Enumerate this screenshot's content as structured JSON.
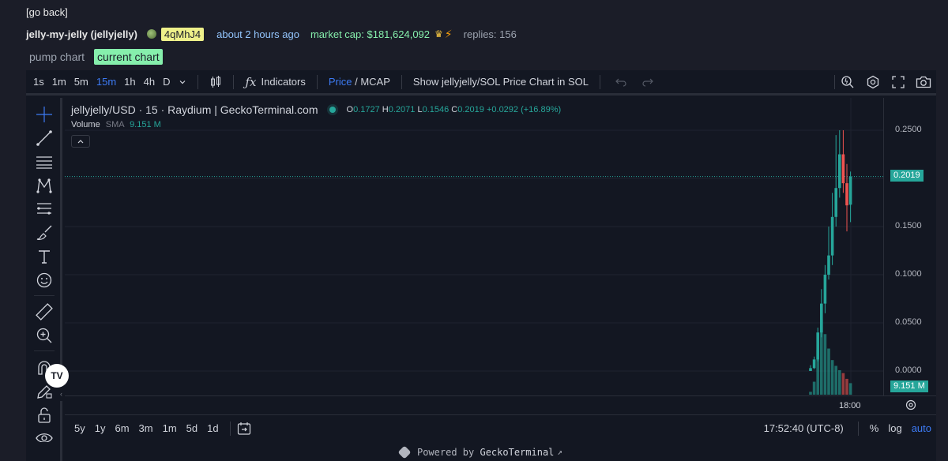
{
  "header": {
    "go_back": "[go back]",
    "token_name": "jelly-my-jelly (jellyjelly)",
    "creator_badge": "4qMhJ4",
    "created_ago": "about 2 hours ago",
    "market_cap": "market cap: $181,624,092",
    "replies": "replies: 156"
  },
  "chart_tabs": [
    {
      "label": "pump chart",
      "active": false
    },
    {
      "label": "current chart",
      "active": true
    }
  ],
  "toolbar": {
    "timeframes": [
      "1s",
      "1m",
      "5m",
      "15m",
      "1h",
      "4h",
      "D"
    ],
    "active_timeframe": "15m",
    "indicators_label": "Indicators",
    "price_label": "Price",
    "slash": " / ",
    "mcap_label": "MCAP",
    "show_sol_label": "Show jellyjelly/SOL Price Chart in SOL"
  },
  "legend": {
    "symbol": "jellyjelly/USD · 15 · Raydium | GeckoTerminal.com",
    "o_key": "O",
    "o_val": "0.1727",
    "h_key": "H",
    "h_val": "0.2071",
    "l_key": "L",
    "l_val": "0.1546",
    "c_key": "C",
    "c_val": "0.2019",
    "change": "+0.0292 (+16.89%)",
    "volume_label": "Volume",
    "sma_label": "SMA",
    "volume_value": "9.151 M"
  },
  "price_scale": {
    "labels": [
      "0.2500",
      "0.1500",
      "0.1000",
      "0.0500",
      "0.0000"
    ],
    "last_price_tag": "0.2019",
    "volume_tag": "9.151 M"
  },
  "time_scale": {
    "label": "18:00"
  },
  "bottom_bar": {
    "ranges": [
      "5y",
      "1y",
      "6m",
      "3m",
      "1m",
      "5d",
      "1d"
    ],
    "clock": "17:52:40 (UTC-8)",
    "percent": "%",
    "log": "log",
    "auto": "auto"
  },
  "footer": {
    "powered_prefix": "Powered by ",
    "powered_brand": "GeckoTerminal",
    "arrow": "↗"
  },
  "colors": {
    "up": "#26a69a",
    "down": "#ef5350",
    "accent": "#3d7bf5",
    "badge": "#eef08a",
    "mcap": "#86efac"
  },
  "chart_data": {
    "type": "candlestick",
    "title": "jellyjelly/USD · 15 · Raydium | GeckoTerminal.com",
    "ylim": [
      -0.01,
      0.26
    ],
    "candles": [
      {
        "o": 0.0,
        "h": 0.006,
        "l": 0.0,
        "c": 0.003,
        "v": 0.1
      },
      {
        "o": 0.003,
        "h": 0.015,
        "l": 0.002,
        "c": 0.012,
        "v": 0.45
      },
      {
        "o": 0.012,
        "h": 0.045,
        "l": 0.01,
        "c": 0.04,
        "v": 1.55
      },
      {
        "o": 0.04,
        "h": 0.085,
        "l": 0.035,
        "c": 0.07,
        "v": 2.6
      },
      {
        "o": 0.07,
        "h": 0.11,
        "l": 0.06,
        "c": 0.1,
        "v": 2.1
      },
      {
        "o": 0.1,
        "h": 0.15,
        "l": 0.095,
        "c": 0.12,
        "v": 1.6
      },
      {
        "o": 0.12,
        "h": 0.185,
        "l": 0.11,
        "c": 0.16,
        "v": 1.2
      },
      {
        "o": 0.16,
        "h": 0.245,
        "l": 0.15,
        "c": 0.19,
        "v": 1.0
      },
      {
        "o": 0.19,
        "h": 0.25,
        "l": 0.18,
        "c": 0.225,
        "v": 0.85
      },
      {
        "o": 0.225,
        "h": 0.25,
        "l": 0.185,
        "c": 0.195,
        "v": 0.75
      },
      {
        "o": 0.195,
        "h": 0.215,
        "l": 0.145,
        "c": 0.172,
        "v": 0.55
      },
      {
        "o": 0.1727,
        "h": 0.2071,
        "l": 0.1546,
        "c": 0.2019,
        "v": 0.4
      }
    ]
  }
}
